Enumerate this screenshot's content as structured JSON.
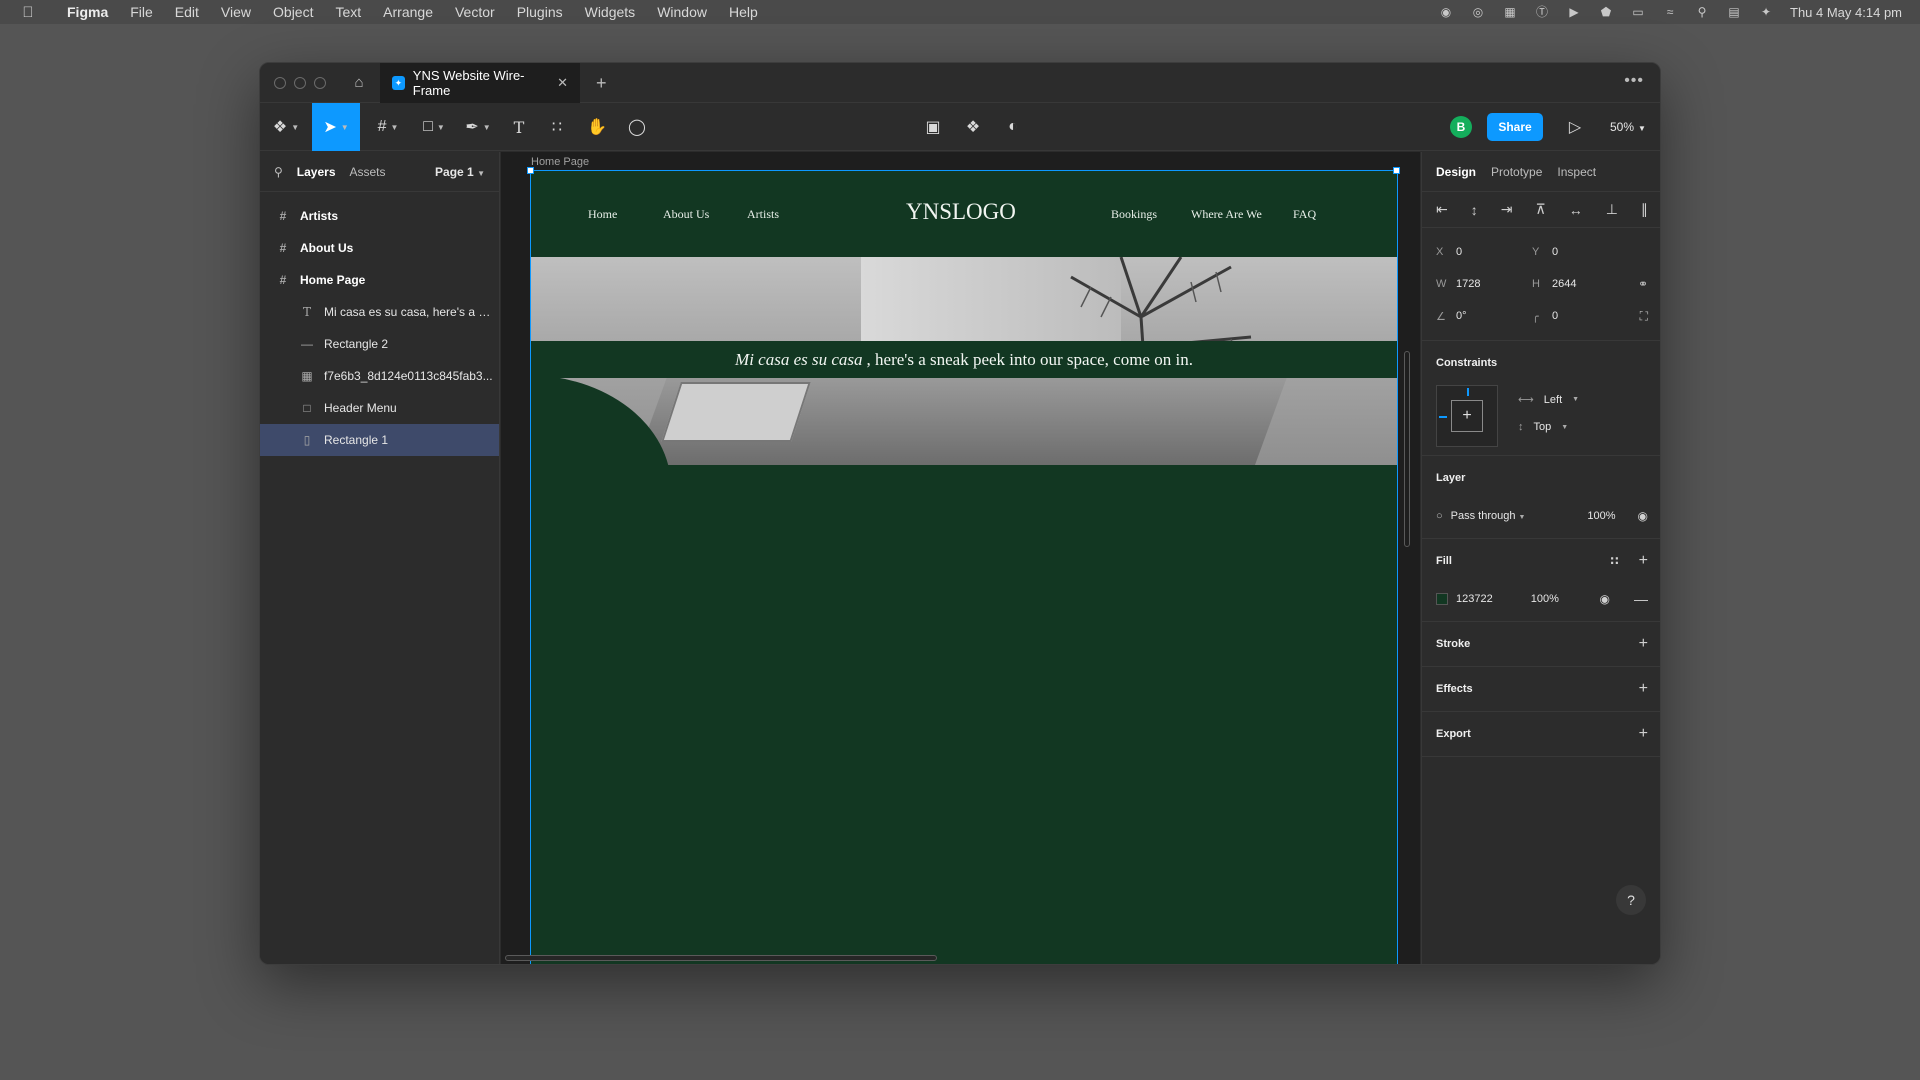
{
  "menubar": {
    "app_name": "Figma",
    "items": [
      "File",
      "Edit",
      "View",
      "Object",
      "Text",
      "Arrange",
      "Vector",
      "Plugins",
      "Widgets",
      "Window",
      "Help"
    ],
    "datetime": "Thu 4 May  4:14 pm"
  },
  "window": {
    "tab_title": "YNS Website Wire-Frame",
    "zoom": "50%",
    "avatar_initial": "B",
    "share_label": "Share"
  },
  "left_panel": {
    "tab_layers": "Layers",
    "tab_assets": "Assets",
    "page_selector": "Page 1",
    "layers": [
      {
        "label": "Artists"
      },
      {
        "label": "About Us"
      },
      {
        "label": "Home Page"
      },
      {
        "label": "Mi casa es su casa, here's a s..."
      },
      {
        "label": "Rectangle 2"
      },
      {
        "label": "f7e6b3_8d124e0113c845fab3..."
      },
      {
        "label": "Header Menu"
      },
      {
        "label": "Rectangle 1"
      }
    ]
  },
  "canvas": {
    "frame_label": "Home Page",
    "site": {
      "nav_left": [
        "Home",
        "About Us",
        "Artists"
      ],
      "logo": "YNSLOGO",
      "nav_right": [
        "Bookings",
        "Where Are We",
        "FAQ"
      ],
      "hero_italic": "Mi casa es su casa",
      "hero_rest": ", here's a sneak peek into our space, come on in."
    },
    "frame_fill": "#123722"
  },
  "right_panel": {
    "tab_design": "Design",
    "tab_prototype": "Prototype",
    "tab_inspect": "Inspect",
    "x": "0",
    "y": "0",
    "w": "1728",
    "h": "2644",
    "rotation": "0°",
    "radius": "0",
    "constraints_title": "Constraints",
    "constraint_h": "Left",
    "constraint_v": "Top",
    "layer_title": "Layer",
    "blend_mode": "Pass through",
    "layer_opacity": "100%",
    "fill_title": "Fill",
    "fill_hex": "123722",
    "fill_opacity": "100%",
    "stroke_title": "Stroke",
    "effects_title": "Effects",
    "export_title": "Export"
  },
  "colors": {
    "accent": "#0d99ff",
    "frame_green": "#123722",
    "avatar_green": "#14ae5c"
  }
}
